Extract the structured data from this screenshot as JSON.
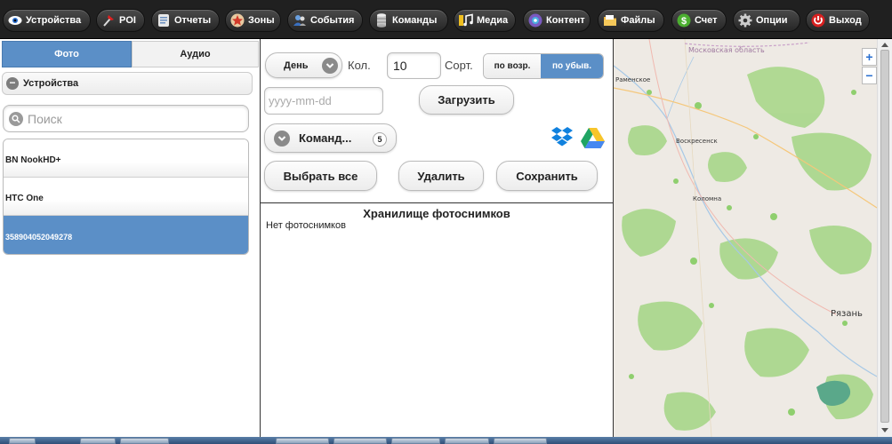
{
  "toolbar": {
    "devices": "Устройства",
    "poi": "POI",
    "reports": "Отчеты",
    "zones": "Зоны",
    "events": "События",
    "commands": "Команды",
    "media": "Медиа",
    "content": "Контент",
    "files": "Файлы",
    "account": "Счет",
    "options": "Опции",
    "exit": "Выход"
  },
  "left": {
    "tabs": {
      "photo": "Фото",
      "audio": "Аудио"
    },
    "devices_header": "Устройства",
    "search_placeholder": "Поиск",
    "devices": [
      {
        "name": "BN NookHD+"
      },
      {
        "name": "HTC One"
      },
      {
        "name": "358904052049278",
        "selected": true
      }
    ]
  },
  "middle": {
    "period": "День",
    "count_label": "Кол.",
    "count_value": "10",
    "sort_label": "Сорт.",
    "sort_asc": "по возр.",
    "sort_desc": "по убыв.",
    "sort_selected": "desc",
    "date_placeholder": "yyyy-mm-dd",
    "load": "Загрузить",
    "commands": "Команд...",
    "commands_count": "5",
    "select_all": "Выбрать все",
    "delete": "Удалить",
    "save": "Сохранить",
    "storage_title": "Хранилище фотоснимков",
    "storage_empty": "Нет фотоснимков"
  },
  "map": {
    "region": "Московская область",
    "ramenskoe": "Раменское",
    "voskresensk": "Воскресенск",
    "kolomna": "Коломна",
    "ryazan": "Рязань",
    "zoom_in": "+",
    "zoom_out": "−"
  },
  "colors": {
    "toolbar_bg": "#202020",
    "accent_blue": "#5b8fc7",
    "map_green": "#9dd37a",
    "map_bg": "#eeeae4"
  }
}
